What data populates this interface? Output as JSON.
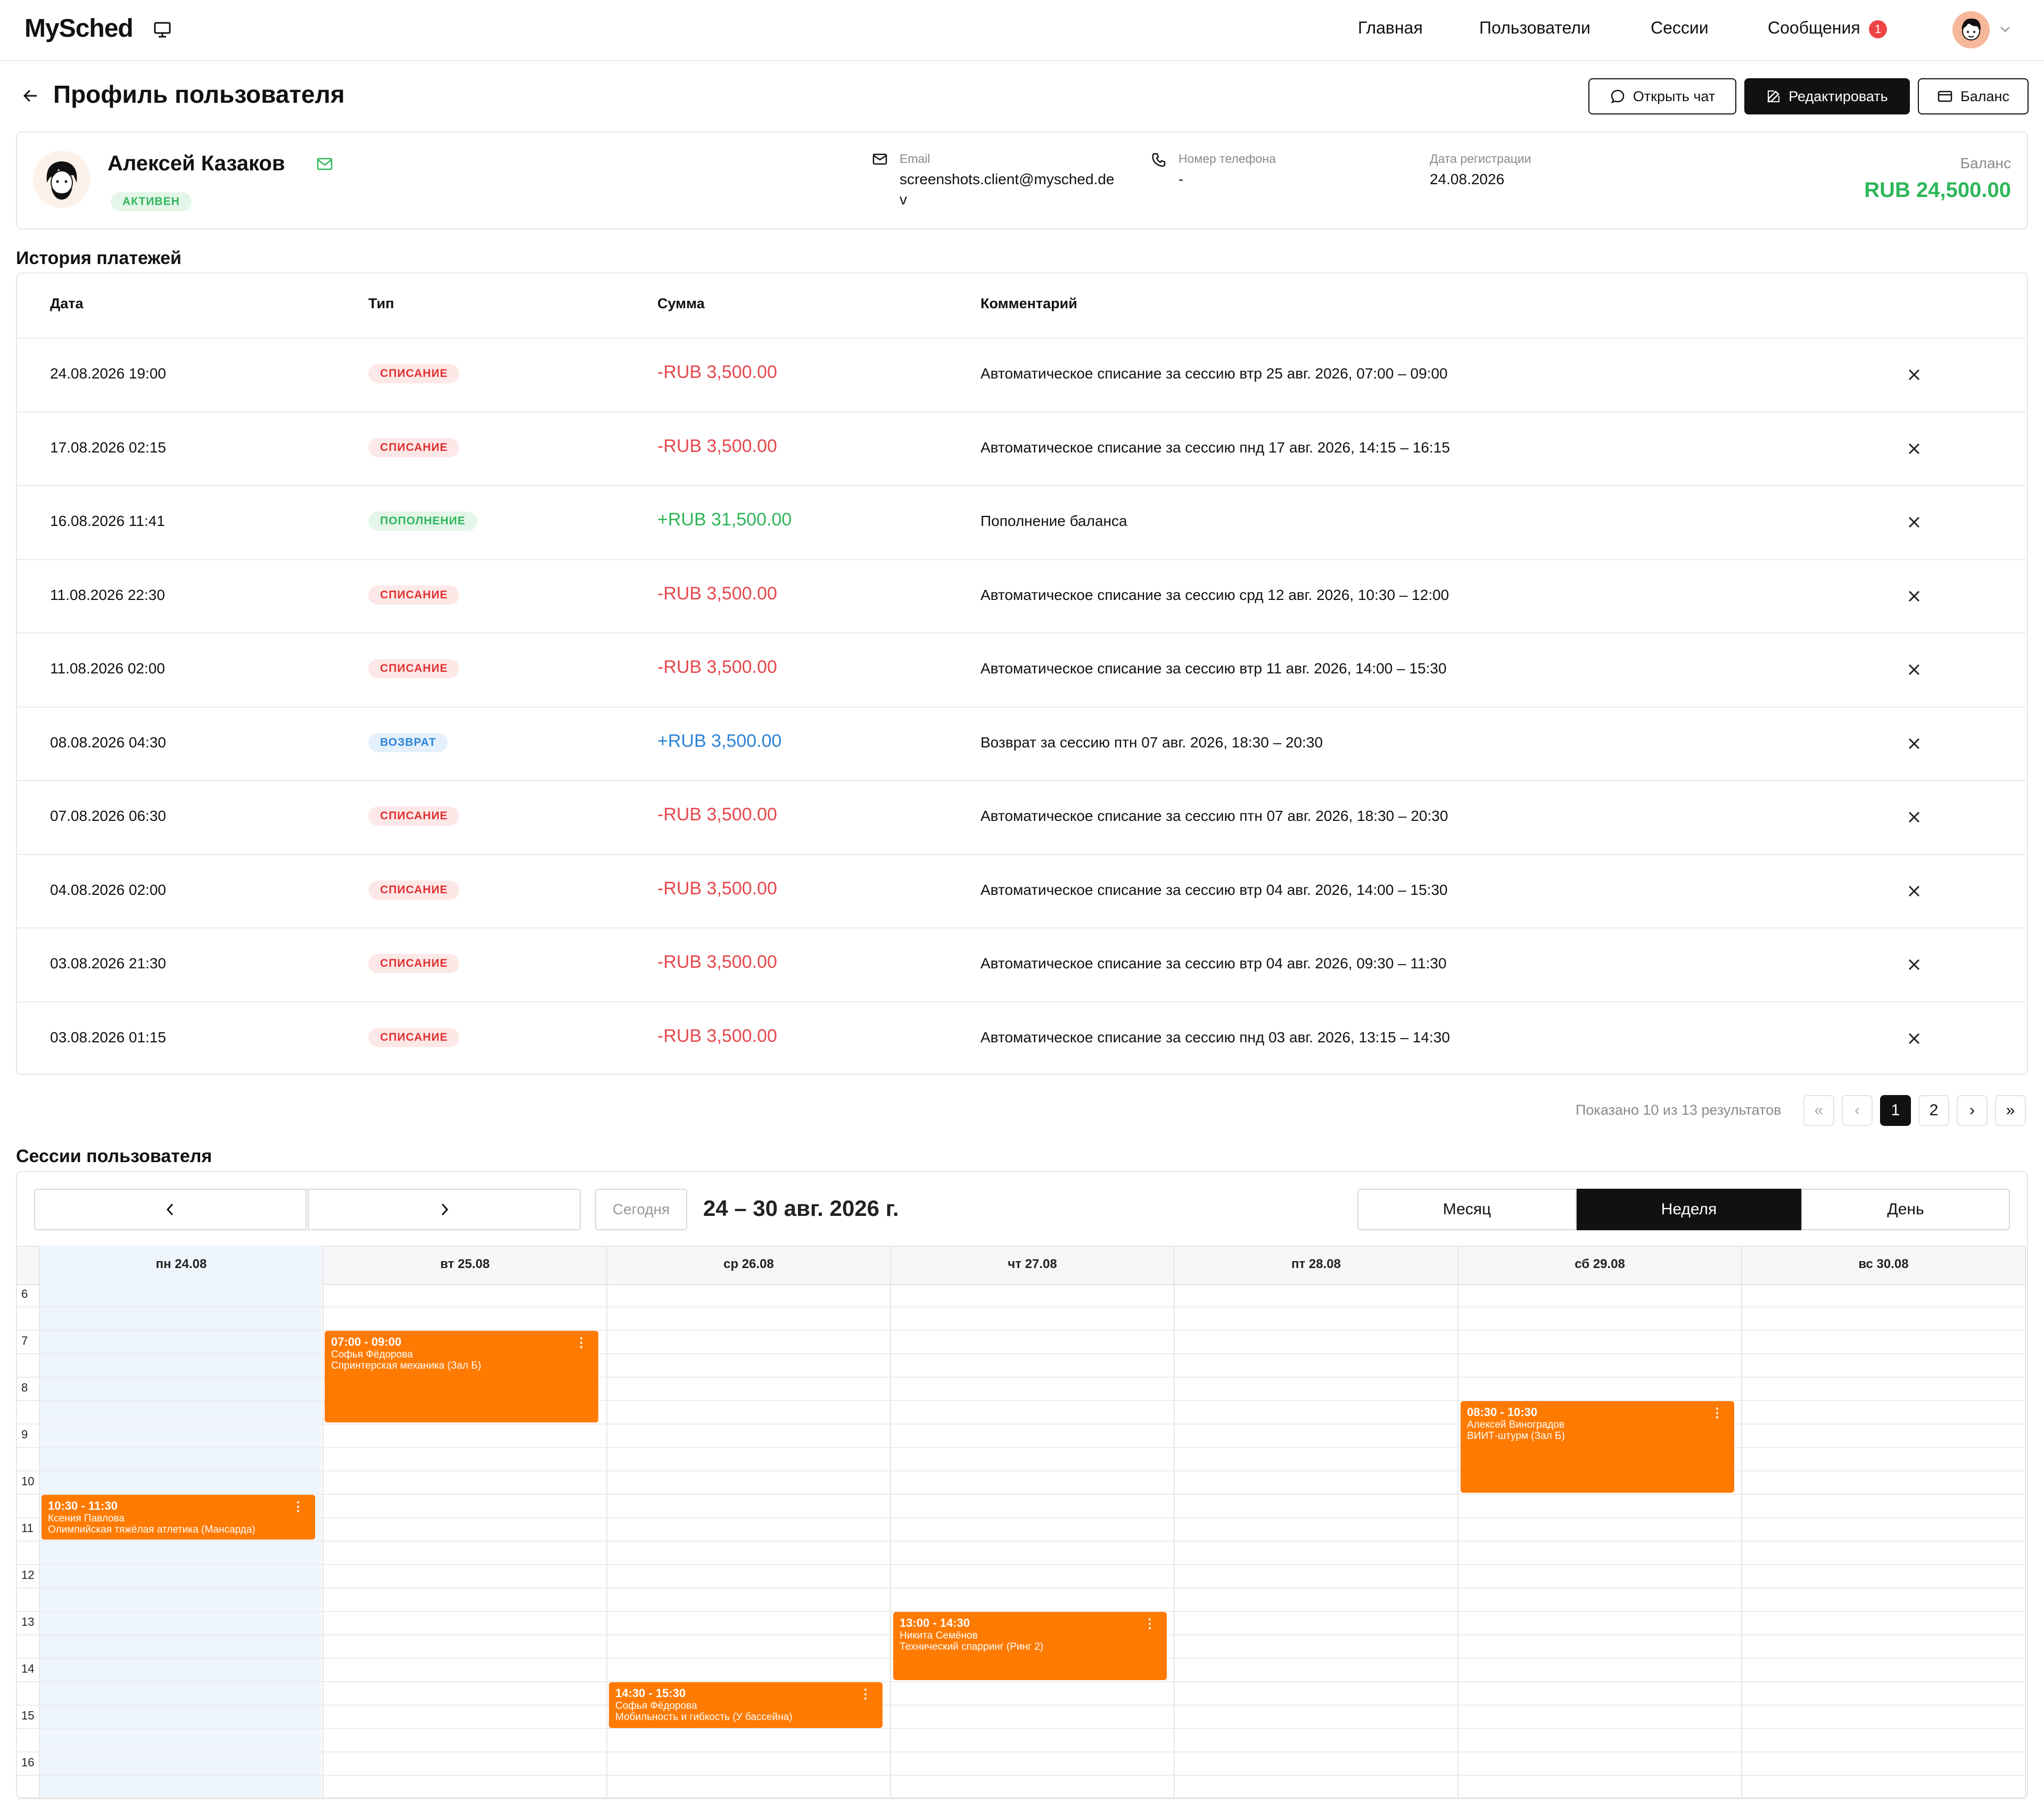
{
  "app": {
    "logo": "MySched"
  },
  "nav": {
    "home": "Главная",
    "users": "Пользователи",
    "sessions": "Сессии",
    "messages": "Сообщения",
    "messages_badge": "1"
  },
  "page": {
    "title": "Профиль пользователя"
  },
  "actions": {
    "open_chat": "Открыть чат",
    "edit": "Редактировать",
    "balance": "Баланс"
  },
  "profile": {
    "name": "Алексей Казаков",
    "status": "АКТИВЕН",
    "email_label": "Email",
    "email_line1": "screenshots.client@mysched.de",
    "email_line2": "v",
    "phone_label": "Номер телефона",
    "phone": "-",
    "reg_label": "Дата регистрации",
    "reg_date": "24.08.2026",
    "balance_label": "Баланс",
    "balance": "RUB 24,500.00"
  },
  "payments": {
    "title": "История платежей",
    "headers": {
      "date": "Дата",
      "type": "Тип",
      "amount": "Сумма",
      "comment": "Комментарий"
    },
    "rows": [
      {
        "date": "24.08.2026 19:00",
        "type": "СПИСАНИЕ",
        "amount": "-RUB 3,500.00",
        "comment": "Автоматическое списание за сессию втр 25 авг. 2026, 07:00 – 09:00"
      },
      {
        "date": "17.08.2026 02:15",
        "type": "СПИСАНИЕ",
        "amount": "-RUB 3,500.00",
        "comment": "Автоматическое списание за сессию пнд 17 авг. 2026, 14:15 – 16:15"
      },
      {
        "date": "16.08.2026 11:41",
        "type": "ПОПОЛНЕНИЕ",
        "amount": "+RUB 31,500.00",
        "comment": "Пополнение баланса"
      },
      {
        "date": "11.08.2026 22:30",
        "type": "СПИСАНИЕ",
        "amount": "-RUB 3,500.00",
        "comment": "Автоматическое списание за сессию срд 12 авг. 2026, 10:30 – 12:00"
      },
      {
        "date": "11.08.2026 02:00",
        "type": "СПИСАНИЕ",
        "amount": "-RUB 3,500.00",
        "comment": "Автоматическое списание за сессию втр 11 авг. 2026, 14:00 – 15:30"
      },
      {
        "date": "08.08.2026 04:30",
        "type": "ВОЗВРАТ",
        "amount": "+RUB 3,500.00",
        "comment": "Возврат за сессию птн 07 авг. 2026, 18:30 – 20:30"
      },
      {
        "date": "07.08.2026 06:30",
        "type": "СПИСАНИЕ",
        "amount": "-RUB 3,500.00",
        "comment": "Автоматическое списание за сессию птн 07 авг. 2026, 18:30 – 20:30"
      },
      {
        "date": "04.08.2026 02:00",
        "type": "СПИСАНИЕ",
        "amount": "-RUB 3,500.00",
        "comment": "Автоматическое списание за сессию втр 04 авг. 2026, 14:00 – 15:30"
      },
      {
        "date": "03.08.2026 21:30",
        "type": "СПИСАНИЕ",
        "amount": "-RUB 3,500.00",
        "comment": "Автоматическое списание за сессию втр 04 авг. 2026, 09:30 – 11:30"
      },
      {
        "date": "03.08.2026 01:15",
        "type": "СПИСАНИЕ",
        "amount": "-RUB 3,500.00",
        "comment": "Автоматическое списание за сессию пнд 03 авг. 2026, 13:15 – 14:30"
      }
    ]
  },
  "pagination": {
    "summary": "Показано 10 из 13 результатов",
    "first": "«",
    "prev": "‹",
    "pages": [
      "1",
      "2"
    ],
    "current": "1",
    "next": "›",
    "last": "»"
  },
  "calendar": {
    "title": "Сессии пользователя",
    "today": "Сегодня",
    "range": "24 – 30 авг. 2026 г.",
    "views": {
      "month": "Месяц",
      "week": "Неделя",
      "day": "День"
    },
    "active_view": "Неделя",
    "days": [
      "пн 24.08",
      "вт 25.08",
      "ср 26.08",
      "чт 27.08",
      "пт 28.08",
      "сб 29.08",
      "вс 30.08"
    ],
    "hours": [
      "6",
      "7",
      "8",
      "9",
      "10",
      "11",
      "12",
      "13",
      "14",
      "15",
      "16"
    ],
    "event_color": "#ff7a00",
    "events": [
      {
        "time": "07:00 - 09:00",
        "coach": "Софья Фёдорова",
        "title": "Спринтерская механика (Зал Б)"
      },
      {
        "time": "08:30 - 10:30",
        "coach": "Алексей Виноградов",
        "title": "ВИИТ-штурм (Зал Б)"
      },
      {
        "time": "10:30 - 11:30",
        "coach": "Ксения Павлова",
        "title": "Олимпийская тяжёлая атлетика (Мансарда)"
      },
      {
        "time": "13:00 - 14:30",
        "coach": "Никита Семёнов",
        "title": "Технический спарринг (Ринг 2)"
      },
      {
        "time": "14:30 - 15:30",
        "coach": "Софья Фёдорова",
        "title": "Мобильность и гибкость (У бассейна)"
      }
    ]
  }
}
